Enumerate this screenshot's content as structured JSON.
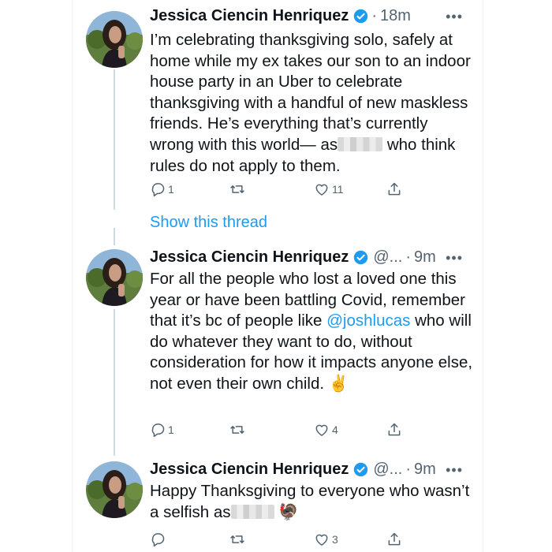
{
  "thread": {
    "show_thread_label": "Show this thread"
  },
  "tweets": [
    {
      "name": "Jessica Ciencin Henriquez",
      "handle": "",
      "dot": "·",
      "time": "18m",
      "more": "•••",
      "text_a": "I’m celebrating thanksgiving solo, safely at home while my ex takes our son to an indoor house party in an Uber to celebrate thanksgiving with a handful of new maskless friends. He’s everything that’s currently wrong with this world— as",
      "text_b": " who think rules do not apply to them.",
      "replies": "1",
      "retweets": "",
      "likes": "11"
    },
    {
      "name": "Jessica Ciencin Henriquez",
      "handle": "@...",
      "dot": "·",
      "time": "9m",
      "more": "•••",
      "text_a": "For all the people who lost a loved one this year or have been battling Covid, remember that it’s bc of people like ",
      "mention": "@joshlucas",
      "text_b": " who will do whatever they want to do, without consideration for how it impacts anyone else, not even their own child. ✌️",
      "replies": "1",
      "retweets": "",
      "likes": "4"
    },
    {
      "name": "Jessica Ciencin Henriquez",
      "handle": "@...",
      "dot": "·",
      "time": "9m",
      "more": "•••",
      "text_a": "Happy Thanksgiving to everyone who wasn’t a selfish as",
      "text_b": "🦃",
      "replies": "",
      "retweets": "",
      "likes": "3"
    }
  ],
  "colors": {
    "link": "#1d9bf0",
    "muted": "#536471",
    "verified": "#1d9bf0",
    "thread_line": "#cfd9de"
  },
  "icons": [
    "verified-badge-icon",
    "more-icon",
    "reply-icon",
    "retweet-icon",
    "like-icon",
    "share-icon"
  ]
}
